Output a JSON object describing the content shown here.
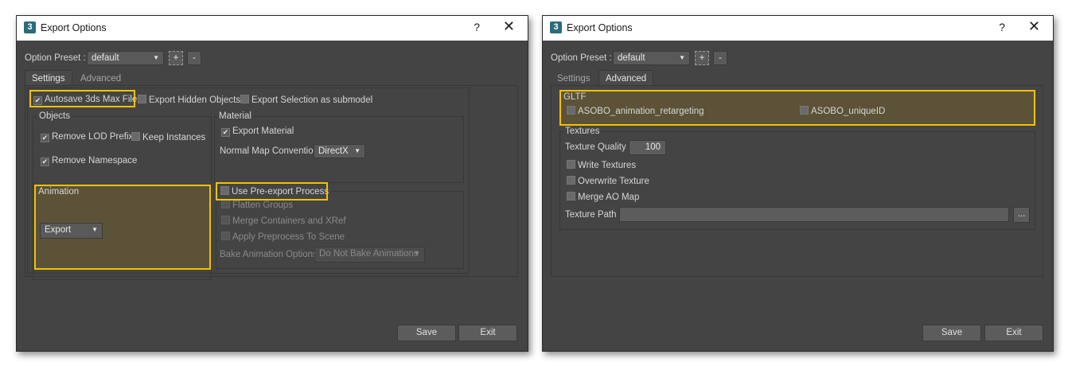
{
  "left_window": {
    "title": "Export Options",
    "app_icon": "3",
    "help": "?",
    "close": "✕",
    "option_preset_label": "Option Preset :",
    "option_preset_value": "default",
    "plus": "+",
    "minus": "-",
    "tabs": [
      "Settings",
      "Advanced"
    ],
    "autosave": "Autosave 3ds Max File",
    "export_hidden": "Export Hidden Objects",
    "export_selection": "Export Selection as submodel",
    "objects_group": "Objects",
    "remove_lod": "Remove LOD Prefix",
    "keep_instances": "Keep Instances",
    "remove_namespace": "Remove Namespace",
    "material_group": "Material",
    "export_material": "Export Material",
    "normal_map_label": "Normal Map Convention",
    "normal_map_value": "DirectX",
    "animation_group": "Animation",
    "animation_value": "Export",
    "use_preexport": "Use Pre-export Process",
    "flatten_groups": "Flatten Groups",
    "merge_containers": "Merge Containers and XRef",
    "apply_preprocess": "Apply Preprocess To Scene",
    "bake_label": "Bake Animation Options",
    "bake_value": "Do Not Bake Animations",
    "save": "Save",
    "exit": "Exit"
  },
  "right_window": {
    "title": "Export Options",
    "app_icon": "3",
    "help": "?",
    "close": "✕",
    "option_preset_label": "Option Preset :",
    "option_preset_value": "default",
    "plus": "+",
    "minus": "-",
    "tabs": [
      "Settings",
      "Advanced"
    ],
    "gltf_group": "GLTF",
    "asobo_retargeting": "ASOBO_animation_retargeting",
    "asobo_uniqueid": "ASOBO_uniqueID",
    "textures_group": "Textures",
    "texture_quality_label": "Texture Quality",
    "texture_quality_value": "100",
    "write_textures": "Write Textures",
    "overwrite_texture": "Overwrite Texture",
    "merge_ao": "Merge AO Map",
    "texture_path_label": "Texture Path",
    "browse": "...",
    "save": "Save",
    "exit": "Exit"
  },
  "colors": {
    "highlight": "#f2c200",
    "window_bg": "#444444",
    "titlebar_bg": "#ffffff"
  },
  "icons": [
    "app-icon",
    "help-icon",
    "close-icon",
    "dropdown-arrow-icon",
    "checkmark-icon"
  ]
}
